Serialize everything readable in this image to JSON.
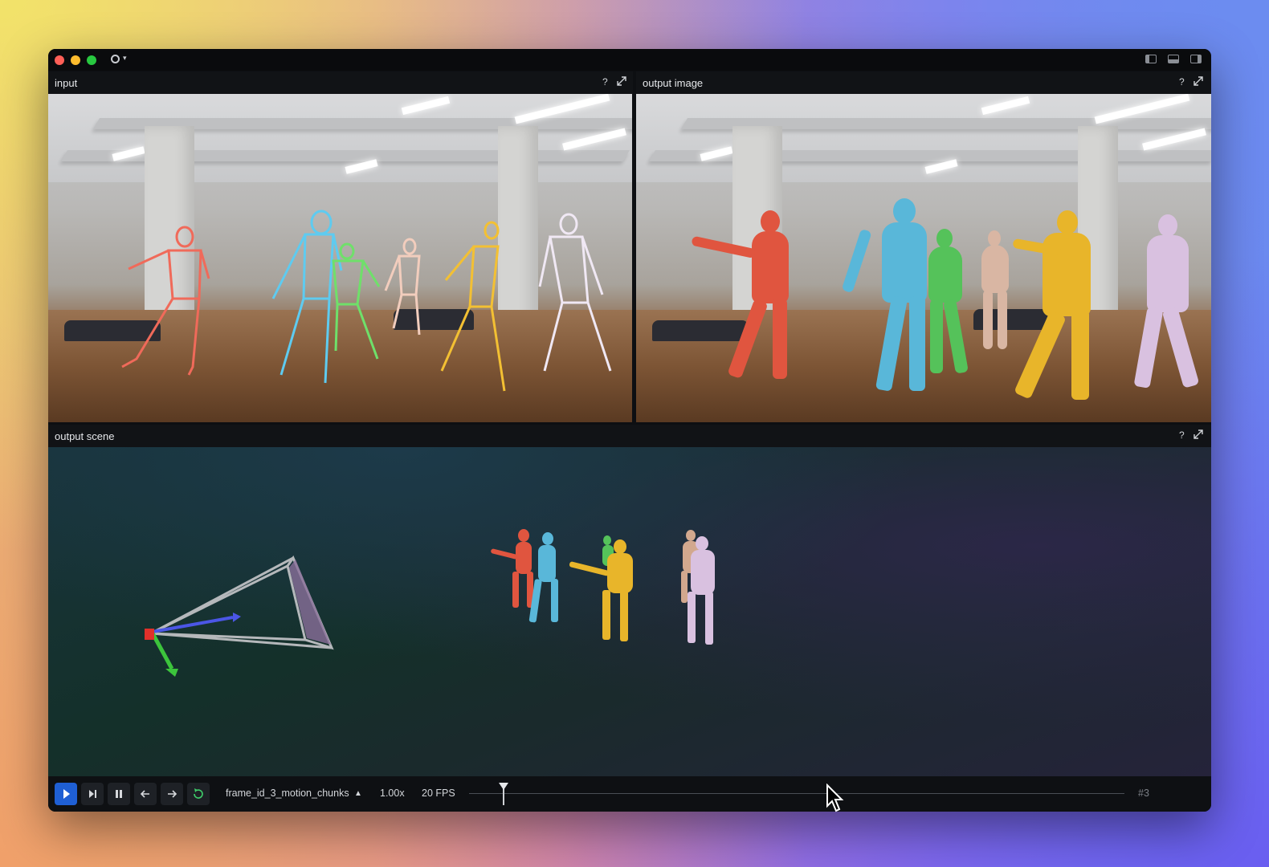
{
  "window": {
    "app_menu_icon": "rerun-logo-icon",
    "layout_icons": [
      "left-panel-icon",
      "bottom-panel-icon",
      "right-panel-icon"
    ]
  },
  "panels": {
    "input": {
      "title": "input",
      "help": "?",
      "expand_icon": "expand-icon"
    },
    "output_image": {
      "title": "output image",
      "help": "?",
      "expand_icon": "expand-icon"
    },
    "output_scene": {
      "title": "output scene",
      "help": "?",
      "expand_icon": "expand-icon"
    }
  },
  "playback": {
    "timeline_name": "frame_id_3_motion_chunks",
    "timeline_caret": "▲",
    "speed": "1.00x",
    "fps": "20 FPS",
    "frame_label": "#3",
    "buttons": [
      "play-icon",
      "step-forward-icon",
      "pause-icon",
      "step-back-icon",
      "step-next-icon",
      "loop-icon"
    ],
    "playhead_fraction": 0.05
  },
  "colors": {
    "person_red": "#e0553f",
    "person_blue": "#59b7d9",
    "person_green": "#55c25a",
    "person_tan": "#d9b6a3",
    "person_yellow": "#e8b52a",
    "person_lilac": "#d9c1e0",
    "play_button": "#1f5fd4",
    "loop_icon": "#3fcf6a"
  }
}
